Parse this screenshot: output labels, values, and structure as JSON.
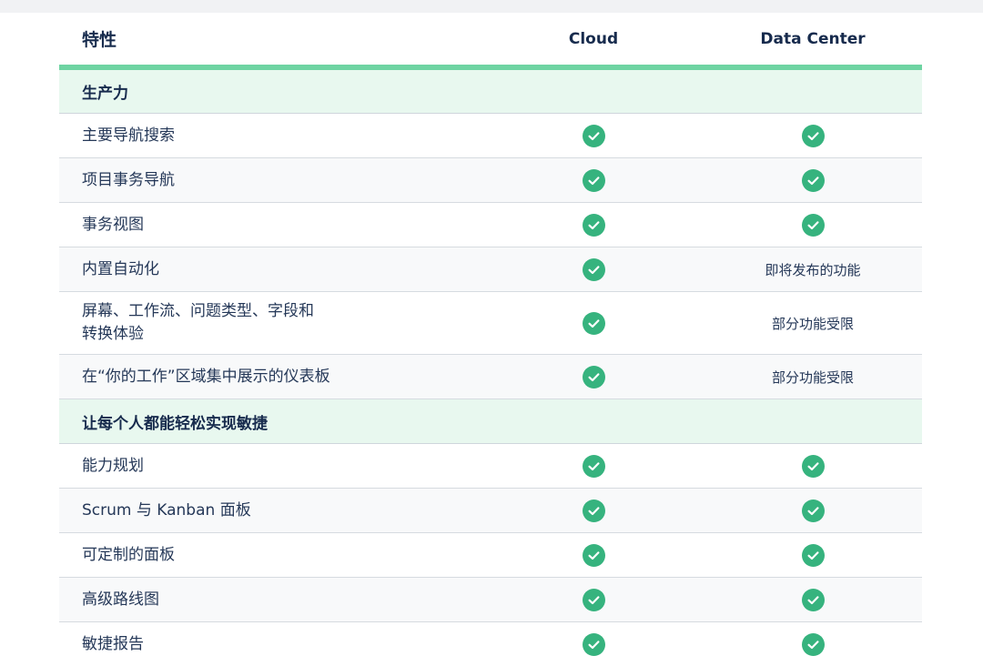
{
  "header": {
    "feature_label": "特性",
    "cloud_label": "Cloud",
    "dc_label": "Data Center"
  },
  "sections": [
    {
      "title": "生产力",
      "rows": [
        {
          "feature": "主要导航搜索",
          "cloud": "check",
          "dc": "check"
        },
        {
          "feature": "项目事务导航",
          "cloud": "check",
          "dc": "check"
        },
        {
          "feature": "事务视图",
          "cloud": "check",
          "dc": "check"
        },
        {
          "feature": "内置自动化",
          "cloud": "check",
          "dc": "即将发布的功能"
        },
        {
          "feature_lines": [
            "屏幕、工作流、问题类型、字段和",
            "转换体验"
          ],
          "cloud": "check",
          "dc": "部分功能受限"
        },
        {
          "feature": "在“你的工作”区域集中展示的仪表板",
          "cloud": "check",
          "dc": "部分功能受限"
        }
      ]
    },
    {
      "title": "让每个人都能轻松实现敏捷",
      "rows": [
        {
          "feature": "能力规划",
          "cloud": "check",
          "dc": "check"
        },
        {
          "feature": "Scrum 与 Kanban 面板",
          "cloud": "check",
          "dc": "check"
        },
        {
          "feature": "可定制的面板",
          "cloud": "check",
          "dc": "check"
        },
        {
          "feature": "高级路线图",
          "cloud": "check",
          "dc": "check"
        },
        {
          "feature": "敏捷报告",
          "cloud": "check",
          "dc": "check"
        }
      ]
    }
  ],
  "colors": {
    "check_green": "#36b37e",
    "header_underline": "#6ed4a2",
    "section_bg": "#e8f8ef",
    "text": "#172b4d"
  },
  "icons": {
    "check": "check-circle-icon"
  }
}
